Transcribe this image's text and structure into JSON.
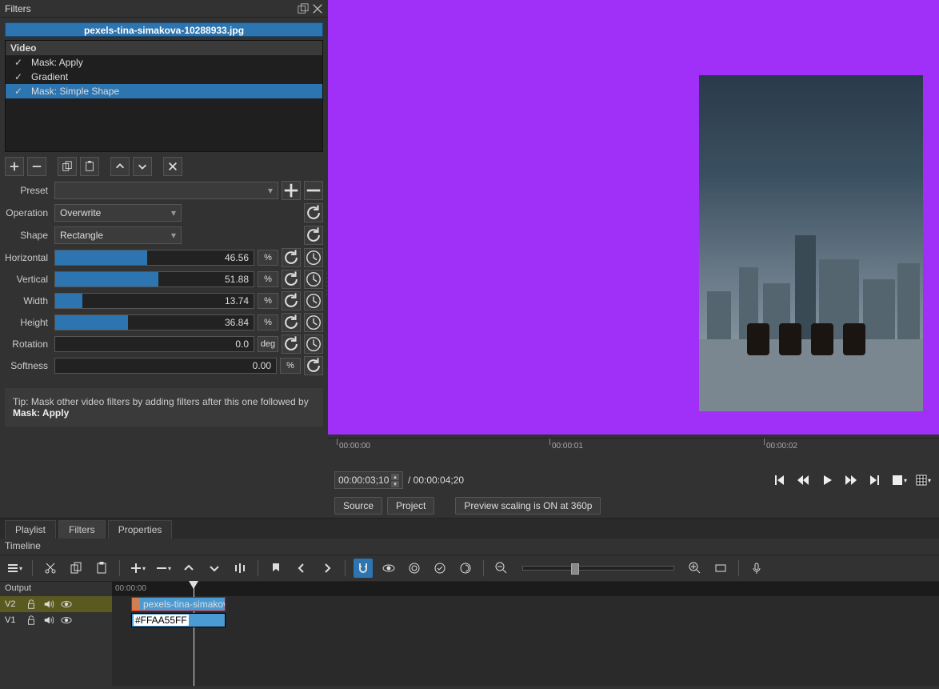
{
  "panel": {
    "title": "Filters"
  },
  "filters": {
    "clip_name": "pexels-tina-simakova-10288933.jpg",
    "group": "Video",
    "items": [
      {
        "label": "Mask: Apply",
        "checked": "✓",
        "selected": false
      },
      {
        "label": "Gradient",
        "checked": "✓",
        "selected": false
      },
      {
        "label": "Mask: Simple Shape",
        "checked": "✓",
        "selected": true
      }
    ]
  },
  "form": {
    "preset_label": "Preset",
    "preset_value": "",
    "operation_label": "Operation",
    "operation_value": "Overwrite",
    "shape_label": "Shape",
    "shape_value": "Rectangle"
  },
  "sliders": {
    "horizontal": {
      "label": "Horizontal",
      "value": "46.56",
      "unit": "%",
      "fill": 46.56
    },
    "vertical": {
      "label": "Vertical",
      "value": "51.88",
      "unit": "%",
      "fill": 51.88
    },
    "width": {
      "label": "Width",
      "value": "13.74",
      "unit": "%",
      "fill": 13.74
    },
    "height": {
      "label": "Height",
      "value": "36.84",
      "unit": "%",
      "fill": 36.84
    },
    "rotation": {
      "label": "Rotation",
      "value": "0.0",
      "unit": "deg",
      "fill": 0
    },
    "softness": {
      "label": "Softness",
      "value": "0.00",
      "unit": "%",
      "fill": 0
    }
  },
  "tip": {
    "prefix": "Tip: Mask other video filters by adding filters after this one followed by ",
    "bold": "Mask: Apply"
  },
  "ruler": {
    "t0": "00:00:00",
    "t1": "00:00:01",
    "t2": "00:00:02"
  },
  "transport": {
    "current": "00:00:03;10",
    "total": "/ 00:00:04;20"
  },
  "src_tabs": {
    "source": "Source",
    "project": "Project",
    "scaling": "Preview scaling is ON at 360p"
  },
  "tabs": {
    "playlist": "Playlist",
    "filters": "Filters",
    "properties": "Properties"
  },
  "timeline": {
    "title": "Timeline",
    "output": "Output",
    "ruler0": "00:00:00",
    "v2": "V2",
    "v1": "V1",
    "clip1": "pexels-tina-simakova",
    "clip2": "#FFAA55FF"
  }
}
